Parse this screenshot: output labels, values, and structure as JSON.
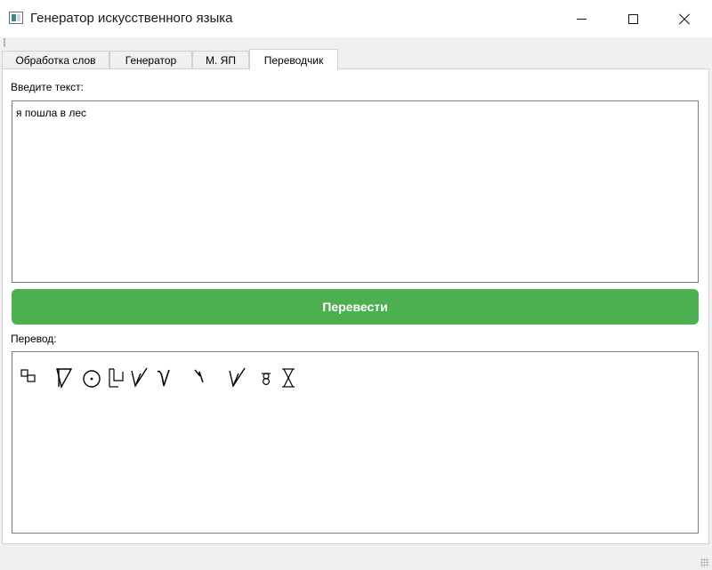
{
  "window": {
    "title": "Генератор искусственного языка"
  },
  "tabs": [
    {
      "label": "Обработка слов",
      "active": false
    },
    {
      "label": "Генератор",
      "active": false
    },
    {
      "label": "М. ЯП",
      "active": false
    },
    {
      "label": "Переводчик",
      "active": true
    }
  ],
  "translator": {
    "input_label": "Введите текст:",
    "input_value": "я пошла в лес",
    "translate_button": "Перевести",
    "output_label": "Перевод:",
    "output_glyphs": [
      "glyph-squares-icon",
      "glyph-triangle-icon",
      "glyph-circle-dot-icon",
      "glyph-bracket-icon",
      "glyph-check-v-icon",
      "glyph-hook-v-icon",
      "glyph-zigzag-icon",
      "glyph-check-v-icon",
      "glyph-eight-icon",
      "glyph-hourglass-icon"
    ]
  },
  "colors": {
    "accent_button": "#4caf50",
    "button_text": "#ffffff"
  }
}
